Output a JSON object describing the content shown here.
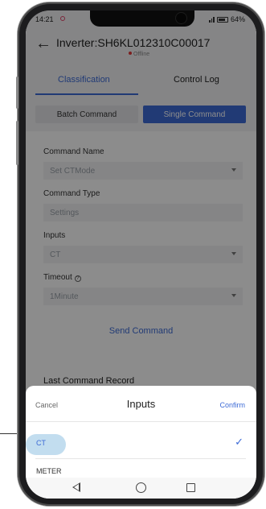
{
  "status_bar": {
    "time": "14:21",
    "battery": "64%"
  },
  "header": {
    "title": "Inverter:SH6KL012310C00017",
    "status": "Offline"
  },
  "tabs": [
    {
      "label": "Classification",
      "active": true
    },
    {
      "label": "Control Log",
      "active": false
    }
  ],
  "segment": {
    "batch_label": "Batch Command",
    "single_label": "Single Command",
    "selected": "Single Command"
  },
  "form": {
    "command_name_label": "Command Name",
    "command_name_value": "Set CTMode",
    "command_type_label": "Command Type",
    "command_type_value": "Settings",
    "inputs_label": "Inputs",
    "inputs_value": "CT",
    "timeout_label": "Timeout",
    "timeout_value": "1Minute",
    "send_button": "Send Command"
  },
  "last_record": {
    "label": "Last Command Record"
  },
  "sheet": {
    "cancel": "Cancel",
    "title": "Inputs",
    "confirm": "Confirm",
    "options": [
      {
        "label": "CT",
        "selected": true
      },
      {
        "label": "METER",
        "selected": false
      }
    ]
  },
  "colors": {
    "accent": "#3d6bd6",
    "offline": "#e23a3a"
  }
}
